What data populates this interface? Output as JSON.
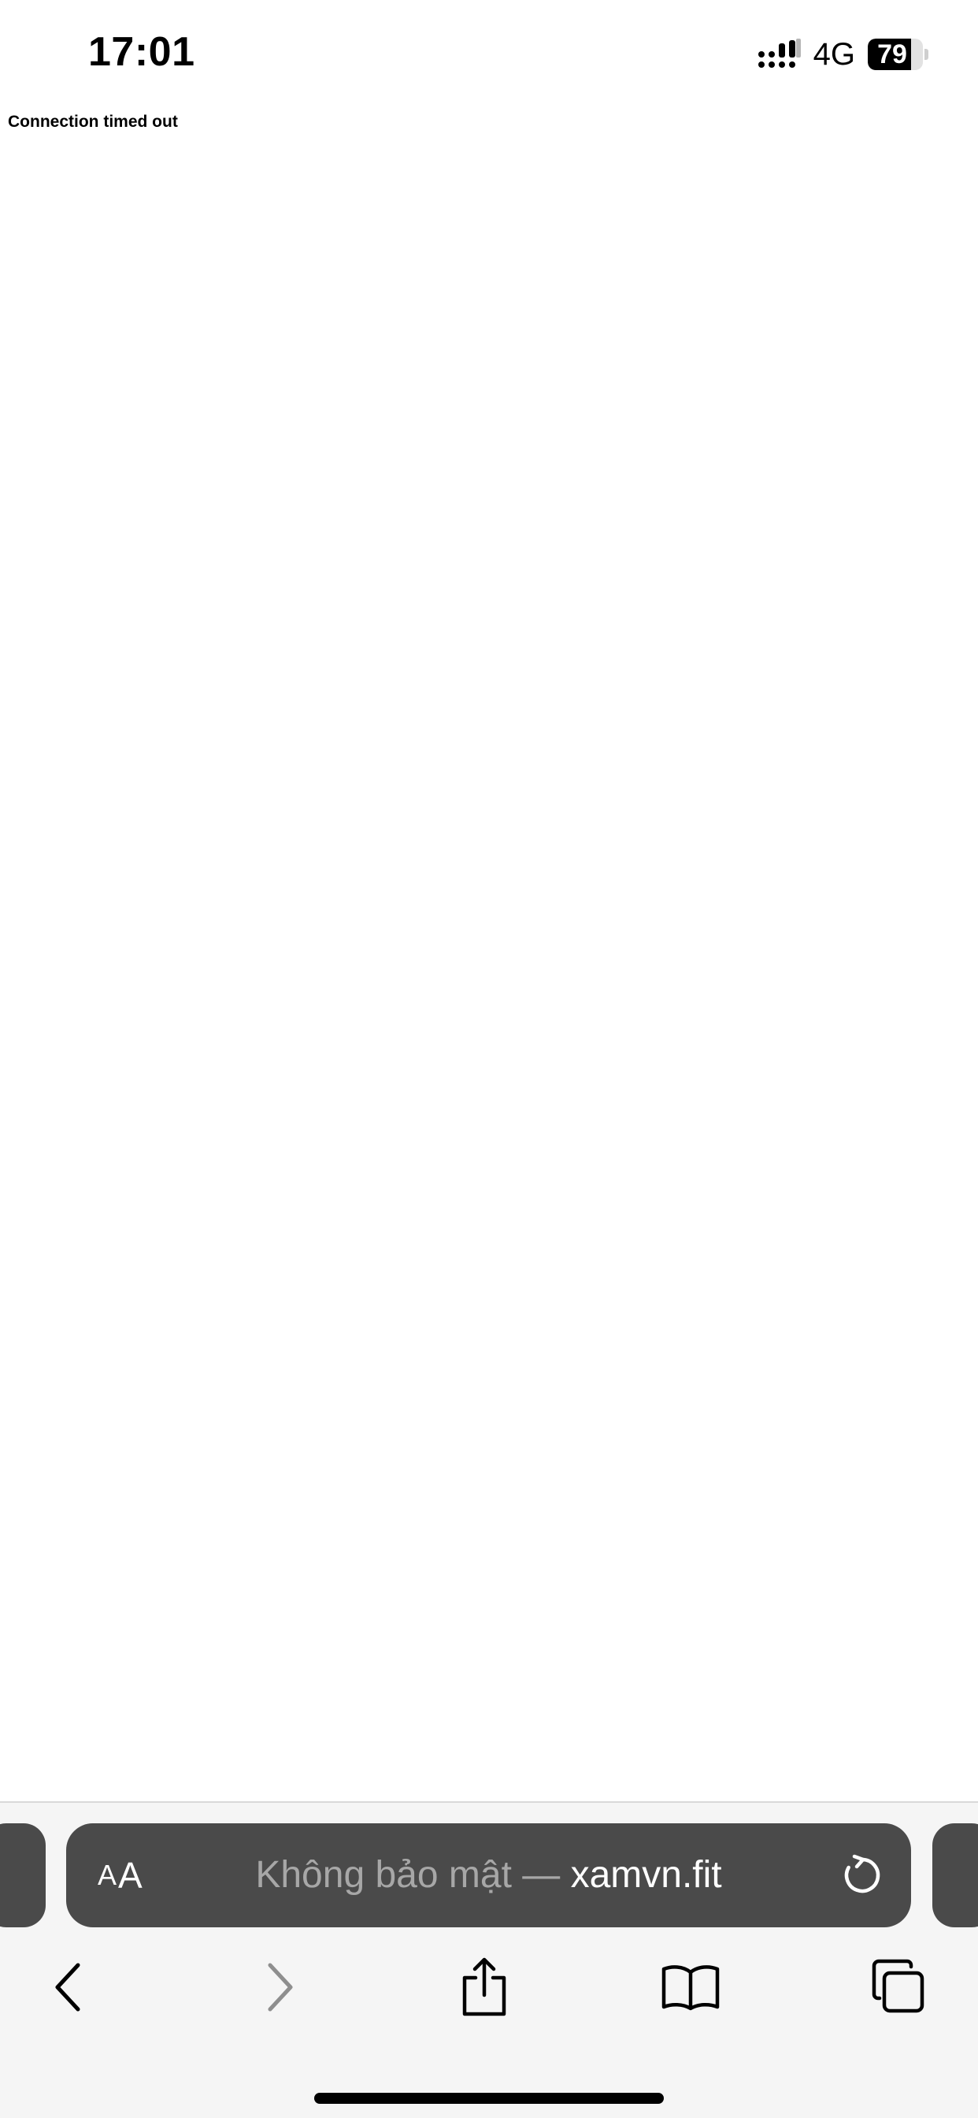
{
  "status_bar": {
    "time": "17:01",
    "network": "4G",
    "battery_level": "79",
    "battery_fraction": 0.79,
    "signal_icon": "signal-bars-icon"
  },
  "page": {
    "error_message": "Connection timed out"
  },
  "browser": {
    "reader_label_small": "A",
    "reader_label_big": "A",
    "url_insecure_label": "Không bảo mật — ",
    "url_domain": "xamvn.fit",
    "icons": {
      "reload": "reload-icon",
      "back": "back-chevron-icon",
      "forward": "forward-chevron-icon",
      "share": "share-icon",
      "bookmarks": "bookmarks-book-icon",
      "tabs": "tabs-icon"
    },
    "colors": {
      "address_bar_bg": "#4a4a4a",
      "chrome_bg": "#f5f5f5",
      "insecure_text": "#a7a7a7"
    }
  }
}
